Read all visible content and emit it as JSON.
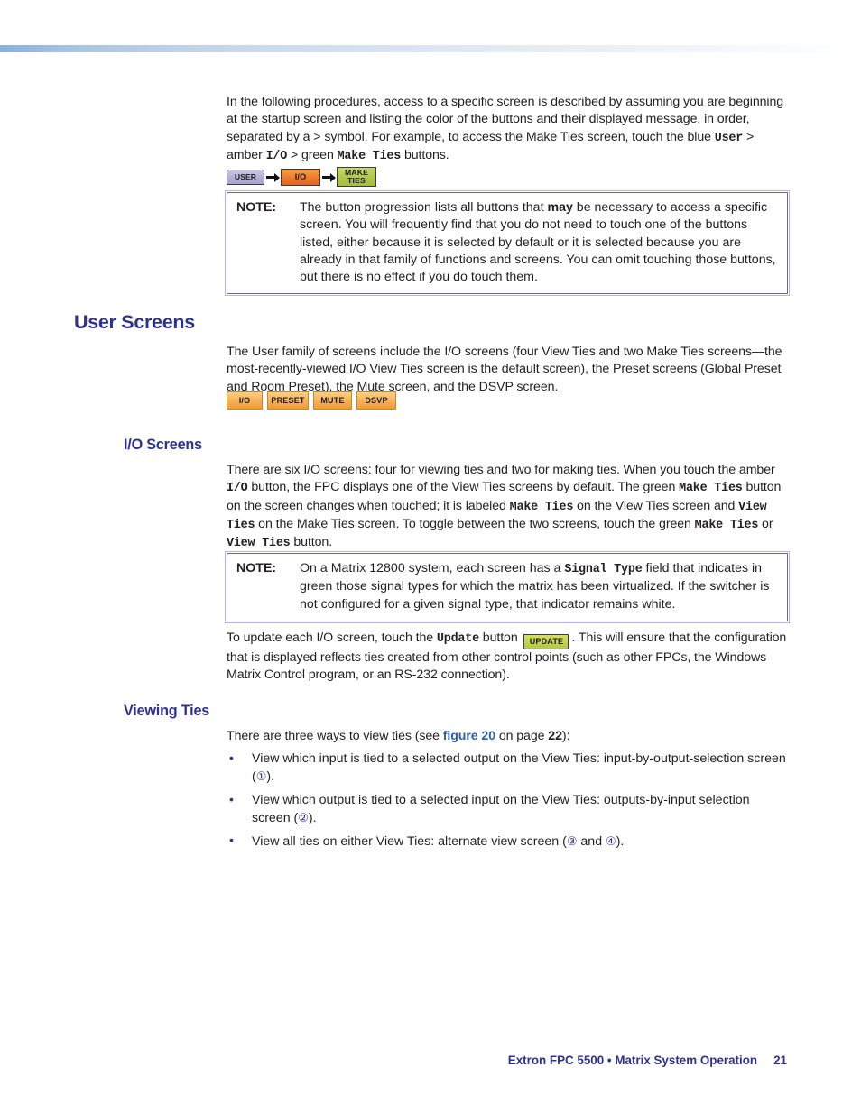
{
  "document": {
    "page_number": "21",
    "footer_title": "Extron FPC 5500 • Matrix System Operation"
  },
  "intro": {
    "paragraph_part1": "In the following procedures, access to a specific screen is described by assuming you are beginning at the startup screen and listing the color of the buttons and their displayed message, in order, separated by a > symbol. For example, to access the Make Ties screen, touch the blue ",
    "user_word": "User",
    "sep1": " > amber ",
    "io_word": "I/O",
    "sep2": " > green ",
    "maketies_word": "Make Ties",
    "paragraph_end": " buttons."
  },
  "button_progression": {
    "buttons": [
      {
        "label": "USER",
        "color_name": "blue",
        "hex": "#b4b0d6"
      },
      {
        "label": "I/O",
        "color_name": "amber",
        "hex": "#ef7f2e"
      },
      {
        "label_line1": "MAKE",
        "label_line2": "TIES",
        "color_name": "green",
        "hex": "#b2c84f"
      }
    ]
  },
  "note1": {
    "label": "NOTE:",
    "text_a": "The button progression lists all buttons that ",
    "bold_may": "may",
    "text_b": " be necessary to access a specific screen. You will frequently find that you do not need to touch one of the buttons listed, either because it is selected by default or it is selected because you are already in that family of functions and screens. You can omit touching those buttons, but there is no effect if you do touch them."
  },
  "user_screens": {
    "heading": "User Screens",
    "paragraph": "The User family of screens include the I/O screens (four View Ties and two Make Ties screens—the most-recently-viewed I/O View Ties screen is the default screen), the Preset screens (Global Preset and Room Preset), the Mute screen, and the DSVP screen.",
    "family_buttons": [
      {
        "label": "I/O"
      },
      {
        "label": "PRESET"
      },
      {
        "label": "MUTE"
      },
      {
        "label": "DSVP"
      }
    ]
  },
  "io_screens": {
    "heading": "I/O Screens",
    "p1_a": "There are six I/O screens: four for viewing ties and two for making ties. When you touch the amber ",
    "p1_io": "I/O",
    "p1_b": " button, the FPC displays one of the View Ties screens by default. The green ",
    "p1_maketies1": "Make Ties",
    "p1_c": " button on the screen changes when touched; it is labeled ",
    "p1_maketies2": "Make Ties",
    "p1_d": " on the View Ties screen and ",
    "p1_viewties1": "View Ties",
    "p1_e": " on the Make Ties screen. To toggle between the two screens, touch the green ",
    "p1_maketies3": "Make Ties",
    "p1_f": " or ",
    "p1_viewties2": "View Ties",
    "p1_g": " button."
  },
  "note2": {
    "label": "NOTE:",
    "text_a": "On a Matrix 12800 system, each screen has a ",
    "signal_type": "Signal Type",
    "text_b": " field that indicates in green those signal types for which the matrix has been virtualized. If the switcher is not configured for a given signal type, that indicator remains white."
  },
  "update_paragraph": {
    "text_a": "To update each I/O screen, touch the ",
    "update_word": "Update",
    "text_b": " button ",
    "button_label": "UPDATE",
    "text_c": ". This will ensure that the configuration that is displayed reflects ties created from other control points (such as other FPCs, the Windows Matrix Control program, or an RS-232 connection)."
  },
  "viewing_ties": {
    "heading": "Viewing Ties",
    "lead_a": "There are three ways to view ties (see ",
    "lead_link": "figure 20",
    "lead_b": " on page ",
    "lead_page": "22",
    "lead_c": "):",
    "bullets": [
      {
        "marker": "•",
        "text_a": "View which input is tied to a selected output on the View Ties: input-by-output-selection screen (",
        "callout": "①",
        "text_b": ")."
      },
      {
        "marker": "•",
        "text_a": "View which output is tied to a selected input on the View Ties: outputs-by-input selection screen (",
        "callout": "②",
        "text_b": ")."
      },
      {
        "marker": "•",
        "text_a": "View all ties on either View Ties: alternate view screen (",
        "callout": "③",
        "text_mid": " and ",
        "callout2": "④",
        "text_b": ")."
      }
    ]
  },
  "colors": {
    "heading_blue": "#2e3192",
    "link_blue": "#2e5fb0",
    "note_border": "#6a63a8",
    "body_text": "#231f20"
  }
}
